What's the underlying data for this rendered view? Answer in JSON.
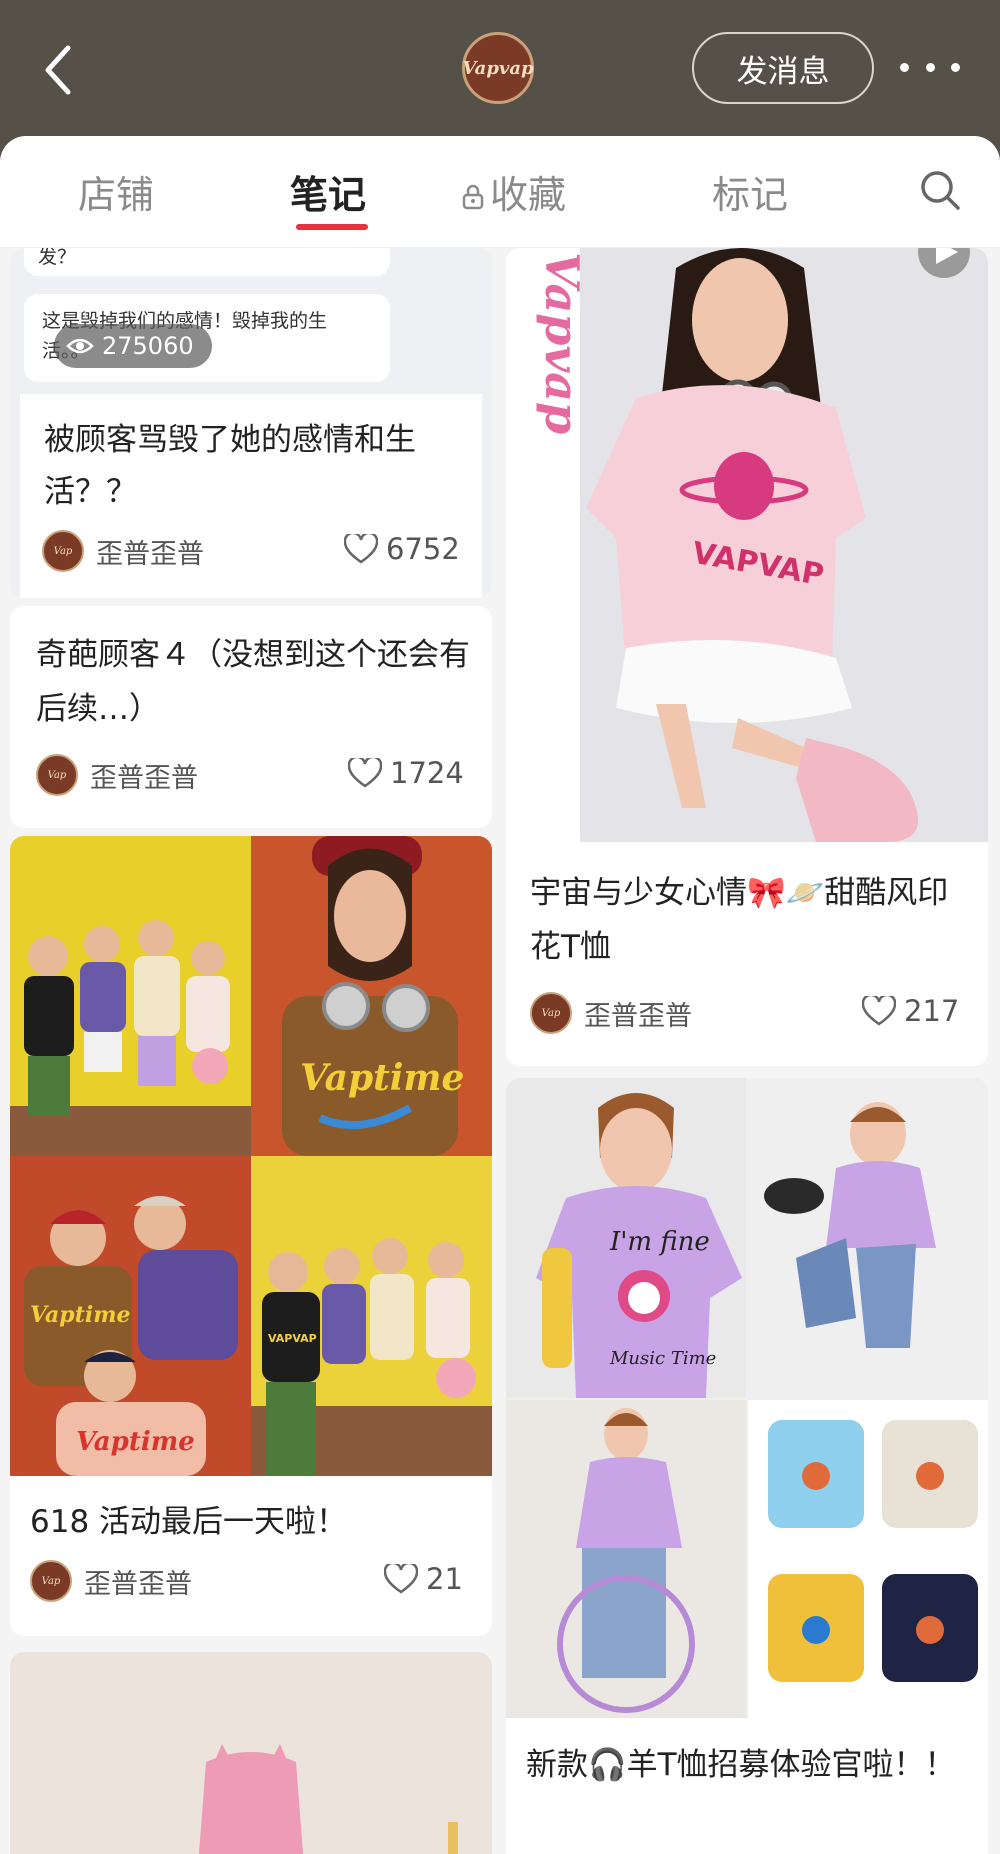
{
  "header": {
    "logo_text": "Vapvap",
    "message_button": "发消息"
  },
  "tabs": [
    {
      "label": "店铺"
    },
    {
      "label": "笔记",
      "active": true
    },
    {
      "label": "收藏",
      "locked": true
    },
    {
      "label": "标记"
    }
  ],
  "left_top_card": {
    "bubble_top_text": "发？",
    "bubble_text": "这是毁掉我们的感情！毁掉我的生活。。",
    "views": "275060",
    "title": "被顾客骂毁了她的感情和生活？？",
    "author": "歪普歪普",
    "likes": "6752"
  },
  "left_card_2": {
    "title": "奇葩顾客４（没想到这个还会有后续…）",
    "author": "歪普歪普",
    "likes": "1724"
  },
  "left_card_3": {
    "title": "618 活动最后一天啦！",
    "author": "歪普歪普",
    "likes": "21",
    "shirt_texts": [
      "Vaptime",
      "Vaptime",
      "VAPVAP",
      "Vaptime"
    ]
  },
  "right_card_1": {
    "brand_side_text": "Vapvap",
    "shirt_text": "VAPVAP",
    "title": "宇宙与少女心情🎀🪐甜酷风印花T恤",
    "author": "歪普歪普",
    "likes": "217"
  },
  "right_card_2": {
    "shirt_text_1": "I'm fine",
    "shirt_text_2": "Music Time",
    "title": "新款🎧羊T恤招募体验官啦！！"
  },
  "colors": {
    "header_bg": "#555148",
    "accent": "#e8303f",
    "brand_brown": "#7a3a26"
  },
  "icons": [
    "back-arrow-icon",
    "more-dots-icon",
    "lock-icon",
    "search-icon",
    "eye-icon",
    "heart-icon",
    "play-icon"
  ]
}
